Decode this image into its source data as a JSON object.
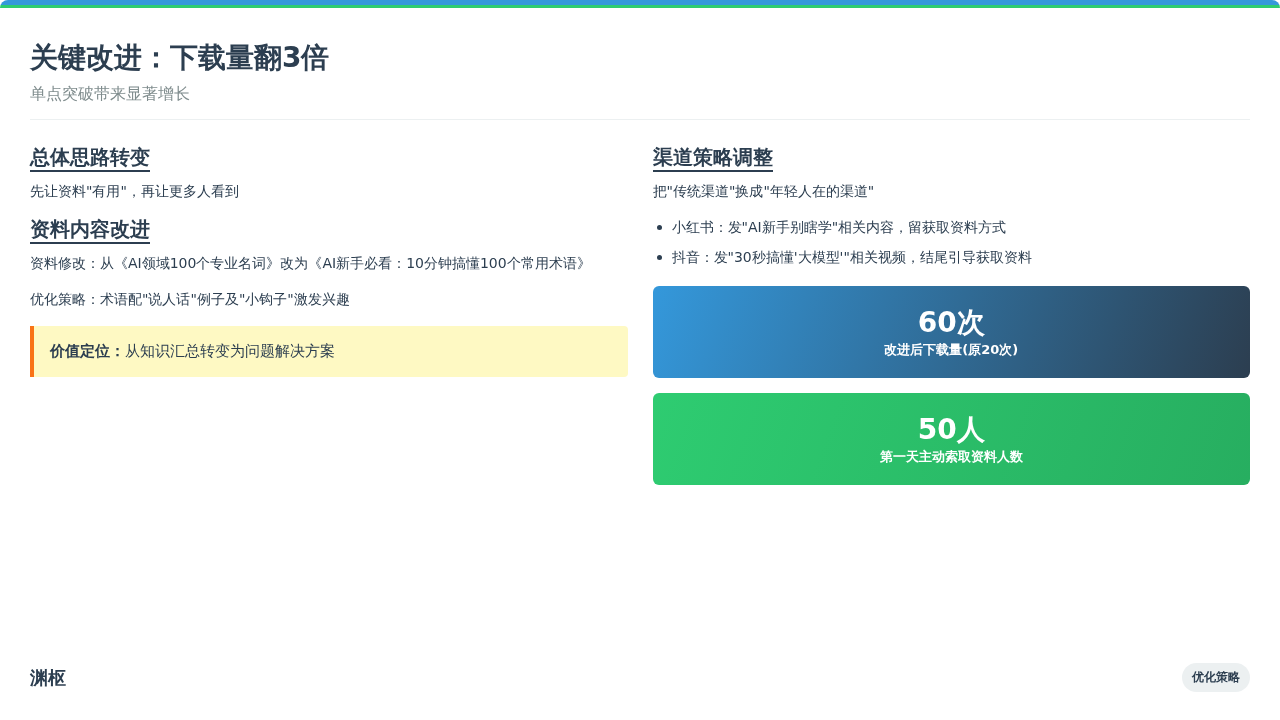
{
  "header": {
    "title": "关键改进：下载量翻3倍",
    "subtitle": "单点突破带来显著增长"
  },
  "left": {
    "sections": [
      {
        "heading": "总体思路转变",
        "paragraphs": [
          "先让资料\"有用\"，再让更多人看到"
        ]
      },
      {
        "heading": "资料内容改进",
        "paragraphs": [
          "资料修改：从《AI领域100个专业名词》改为《AI新手必看：10分钟搞懂100个常用术语》",
          "优化策略：术语配\"说人话\"例子及\"小钩子\"激发兴趣"
        ]
      }
    ],
    "callout": "**价值定位：**从知识汇总转变为问题解决方案"
  },
  "right": {
    "heading": "渠道策略调整",
    "intro": "把\"传统渠道\"换成\"年轻人在的渠道\"",
    "bullets": [
      "小红书：发\"AI新手别瞎学\"相关内容，留获取资料方式",
      "抖音：发\"30秒搞懂'大模型'\"相关视频，结尾引导获取资料"
    ],
    "stats": [
      {
        "kind": "blue",
        "value": "60次",
        "label": "改进后下载量(原20次)"
      },
      {
        "kind": "green",
        "value": "50人",
        "label": "第一天主动索取资料人数"
      }
    ]
  },
  "footer": {
    "brand": "渊枢",
    "tag": "优化策略"
  }
}
